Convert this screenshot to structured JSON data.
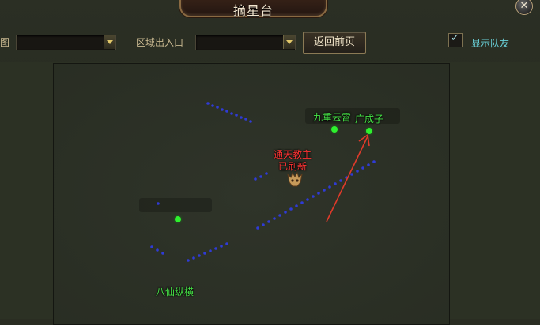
{
  "window": {
    "title": "摘星台",
    "close_glyph": "✕"
  },
  "toolbar": {
    "map_label": "图",
    "region_label": "区域出入口",
    "back_button": "返回前页",
    "show_team_label": "显示队友",
    "show_team_checked": true
  },
  "map": {
    "labels": {
      "jiuchong": "九重云霄",
      "guangchengzi": "广成子",
      "tongtian_line1": "通天教主",
      "tongtian_line2": "已刷新",
      "baxian": "八仙纵横"
    },
    "icons": [
      "boss-skull-icon",
      "annotation-arrow-icon"
    ],
    "colors": {
      "npc_label": "#46e246",
      "boss_label": "#ff3434",
      "path": "#2f3bd6",
      "arrow": "#e03a2a"
    }
  }
}
